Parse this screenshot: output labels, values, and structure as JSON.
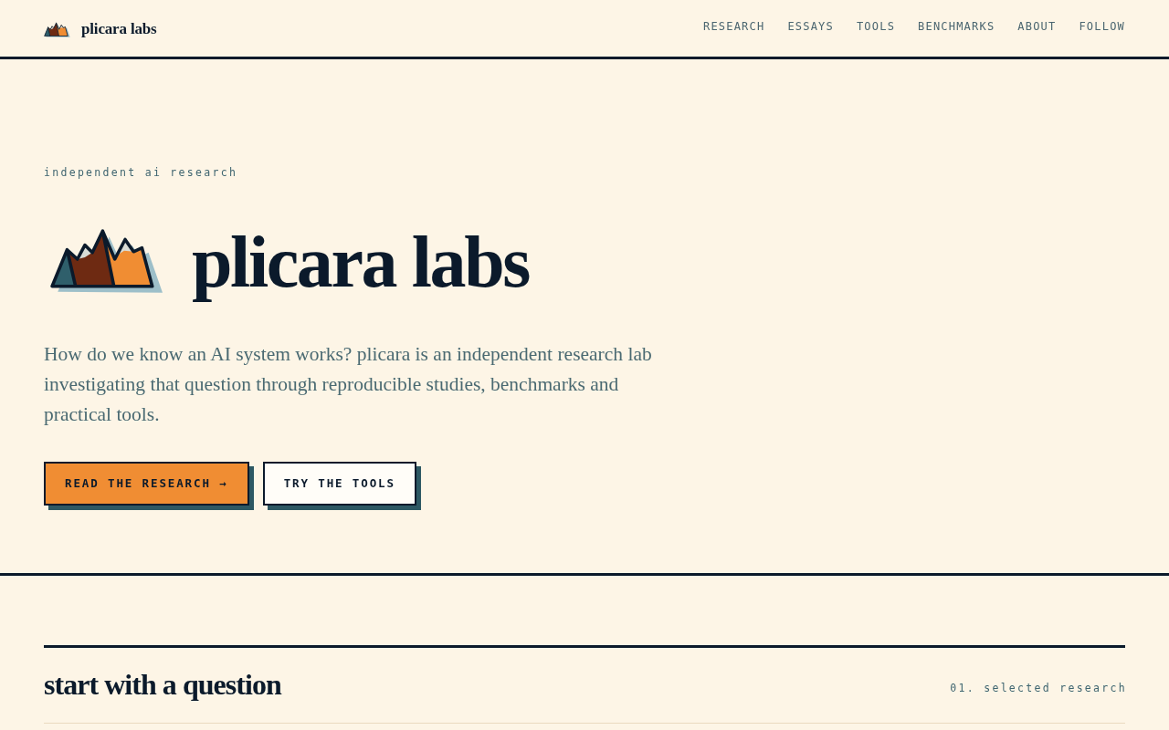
{
  "header": {
    "brand": "plicara labs",
    "nav": [
      "RESEARCH",
      "ESSAYS",
      "TOOLS",
      "BENCHMARKS",
      "ABOUT",
      "FOLLOW"
    ]
  },
  "hero": {
    "eyebrow": "independent ai research",
    "title": "plicara labs",
    "intro": "How do we know an AI system works? plicara is an independent research lab investigating that question through reproducible studies, benchmarks and practical tools.",
    "buttons": [
      {
        "label": "READ THE RESEARCH →",
        "kind": "primary"
      },
      {
        "label": "TRY THE TOOLS",
        "kind": "secondary"
      }
    ]
  },
  "section": {
    "heading": "start with a question",
    "index": "01. selected research"
  }
}
